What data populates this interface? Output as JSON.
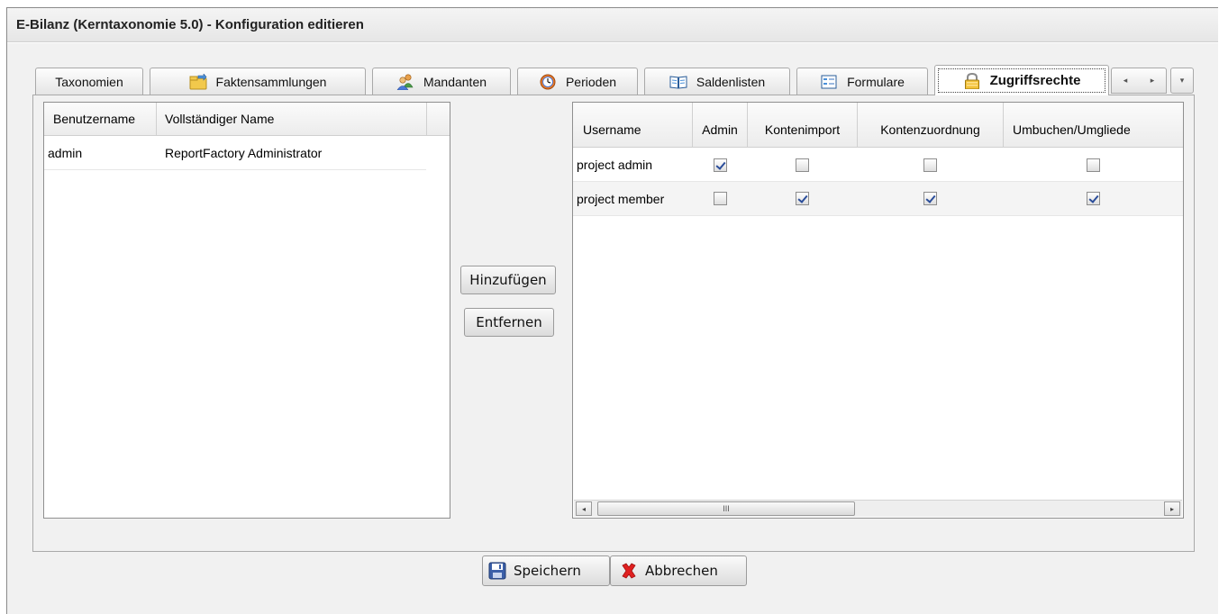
{
  "window": {
    "title": "E-Bilanz (Kerntaxonomie 5.0) - Konfiguration editieren"
  },
  "tabs": [
    {
      "label": "Taxonomien",
      "icon": "none"
    },
    {
      "label": "Faktensammlungen",
      "icon": "folder-export-icon"
    },
    {
      "label": "Mandanten",
      "icon": "users-icon"
    },
    {
      "label": "Perioden",
      "icon": "clock-icon"
    },
    {
      "label": "Saldenlisten",
      "icon": "book-icon"
    },
    {
      "label": "Formulare",
      "icon": "form-icon"
    },
    {
      "label": "Zugriffsrechte",
      "icon": "lock-icon",
      "active": true
    }
  ],
  "tab_nav": {
    "prev": "◂",
    "next": "▸",
    "menu": "▾"
  },
  "users_grid": {
    "columns": [
      "Benutzername",
      "Vollständiger Name"
    ],
    "rows": [
      {
        "username": "admin",
        "fullname": "ReportFactory Administrator"
      }
    ]
  },
  "actions": {
    "add": "Hinzufügen",
    "remove": "Entfernen"
  },
  "rights_grid": {
    "columns": [
      "Username",
      "Admin",
      "Kontenimport",
      "Kontenzuordnung",
      "Umbuchen/Umgliede"
    ],
    "rows": [
      {
        "username": "project admin",
        "admin": true,
        "kontenimport": false,
        "kontenzuordnung": false,
        "umbuchen": false
      },
      {
        "username": "project member",
        "admin": false,
        "kontenimport": true,
        "kontenzuordnung": true,
        "umbuchen": true
      }
    ],
    "scroll_thumb": "III",
    "scroll_left": "◂",
    "scroll_right": "▸"
  },
  "footer": {
    "save": "Speichern",
    "cancel": "Abbrechen"
  },
  "colors": {
    "check": "#2a4d9a",
    "cancel_x": "#e02020",
    "save_icon": "#3b5fa8"
  }
}
